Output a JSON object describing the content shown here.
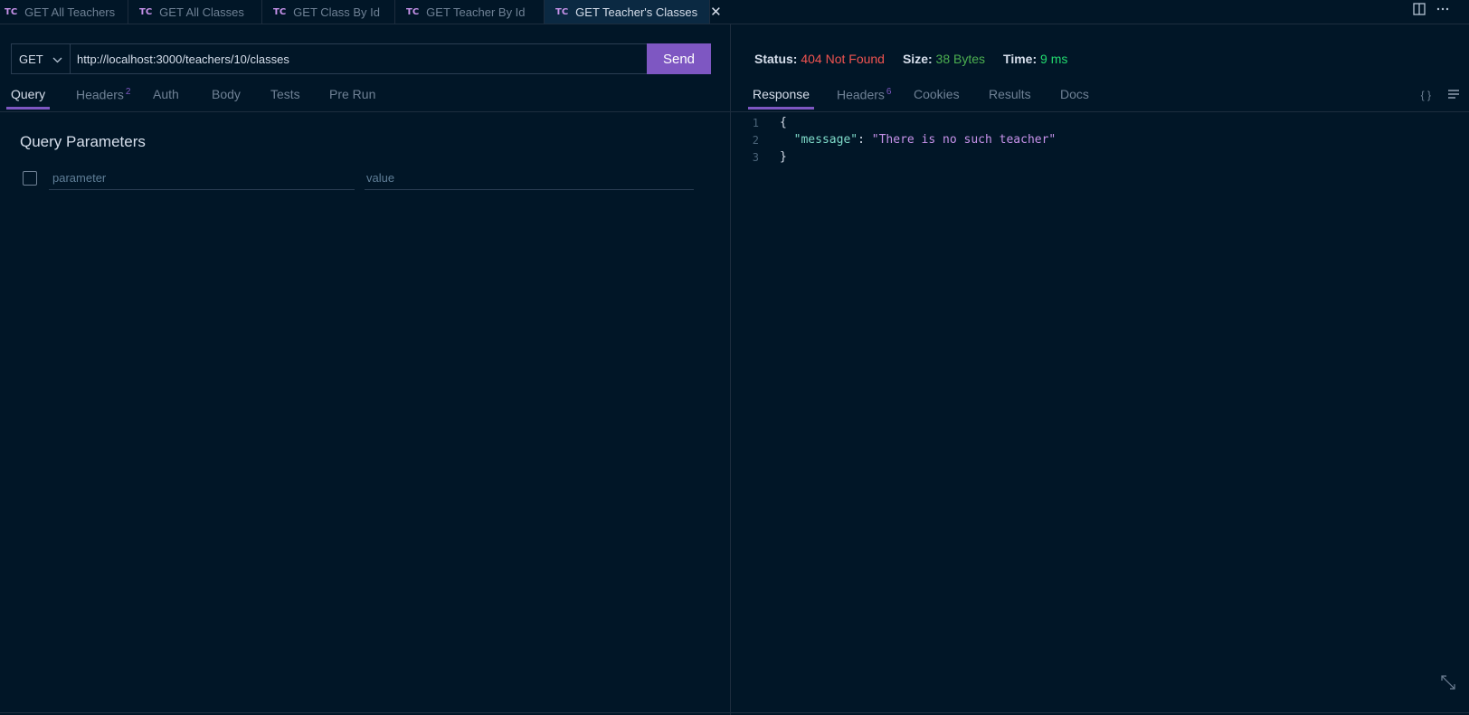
{
  "tabs": [
    {
      "badge": "TC",
      "label": "GET All Teachers",
      "active": false
    },
    {
      "badge": "TC",
      "label": "GET All Classes",
      "active": false
    },
    {
      "badge": "TC",
      "label": "GET Class By Id",
      "active": false
    },
    {
      "badge": "TC",
      "label": "GET Teacher By Id",
      "active": false
    },
    {
      "badge": "TC",
      "label": "GET Teacher's Classes",
      "active": true
    }
  ],
  "tab_strip_icons": [
    "split-editor-icon",
    "more-actions-icon"
  ],
  "request": {
    "method": "GET",
    "url": "http://localhost:3000/teachers/10/classes",
    "send_label": "Send"
  },
  "request_tabs": [
    {
      "label": "Query",
      "count": "",
      "active": true
    },
    {
      "label": "Headers",
      "count": "2",
      "active": false
    },
    {
      "label": "Auth",
      "count": "",
      "active": false
    },
    {
      "label": "Body",
      "count": "",
      "active": false
    },
    {
      "label": "Tests",
      "count": "",
      "active": false
    },
    {
      "label": "Pre Run",
      "count": "",
      "active": false
    }
  ],
  "query": {
    "title": "Query Parameters",
    "param_placeholder": "parameter",
    "value_placeholder": "value"
  },
  "response_status": {
    "status_label": "Status:",
    "status_value": "404 Not Found",
    "size_label": "Size:",
    "size_value": "38 Bytes",
    "time_label": "Time:",
    "time_value": "9 ms"
  },
  "response_tabs": [
    {
      "label": "Response",
      "count": "",
      "active": true
    },
    {
      "label": "Headers",
      "count": "6",
      "active": false
    },
    {
      "label": "Cookies",
      "count": "",
      "active": false
    },
    {
      "label": "Results",
      "count": "",
      "active": false
    },
    {
      "label": "Docs",
      "count": "",
      "active": false
    }
  ],
  "response_body": [
    {
      "line": "1",
      "indent": "",
      "key": "",
      "sep": "",
      "value": "",
      "text": "{"
    },
    {
      "line": "2",
      "indent": "  ",
      "key": "\"message\"",
      "sep": ": ",
      "value": "\"There is no such teacher\"",
      "text": ""
    },
    {
      "line": "3",
      "indent": "",
      "key": "",
      "sep": "",
      "value": "",
      "text": "}"
    }
  ],
  "colors": {
    "background": "#011627",
    "accent": "#7e57c2",
    "status_error": "#ef5350",
    "status_ok": "#22da6e",
    "json_key": "#7fdbca",
    "json_string": "#c792ea"
  }
}
